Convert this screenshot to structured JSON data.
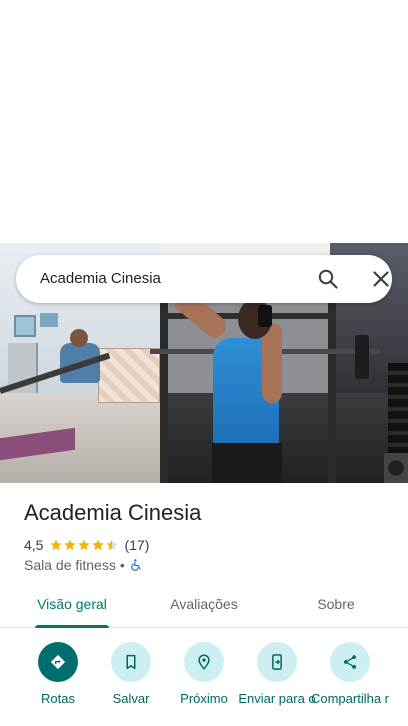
{
  "search": {
    "query": "Academia Cinesia"
  },
  "place": {
    "name": "Academia Cinesia",
    "rating": "4,5",
    "stars": 4.5,
    "review_count": "(17)",
    "category": "Sala de fitness",
    "separator": "•"
  },
  "tabs": [
    {
      "label": "Visão geral",
      "active": true
    },
    {
      "label": "Avaliações",
      "active": false
    },
    {
      "label": "Sobre",
      "active": false
    }
  ],
  "actions": [
    {
      "label": "Rotas",
      "icon": "directions-icon"
    },
    {
      "label": "Salvar",
      "icon": "bookmark-icon"
    },
    {
      "label": "Próximo",
      "icon": "nearby-icon"
    },
    {
      "label": "Enviar para o",
      "icon": "send-to-phone-icon"
    },
    {
      "label": "Compartilha r",
      "icon": "share-icon"
    }
  ],
  "colors": {
    "accent": "#00796b",
    "action_circle": "#cdeff1",
    "primary_circle": "#006d6f",
    "star": "#f4b400"
  }
}
